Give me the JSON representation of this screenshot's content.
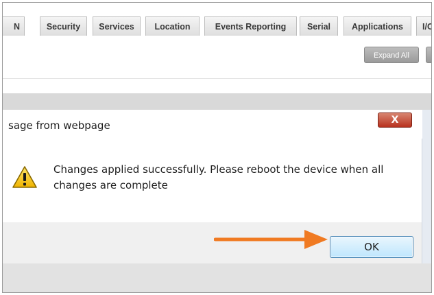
{
  "tabs": [
    {
      "label": "N"
    },
    {
      "label": "Security"
    },
    {
      "label": "Services"
    },
    {
      "label": "Location"
    },
    {
      "label": "Events Reporting"
    },
    {
      "label": "Serial"
    },
    {
      "label": "Applications"
    },
    {
      "label": "I/O"
    }
  ],
  "toolbar": {
    "expand_all_label": "Expand All"
  },
  "dialog": {
    "title": "sage from webpage",
    "close_label": "X",
    "message": "Changes applied successfully. Please reboot the device when all changes are complete",
    "ok_label": "OK",
    "icon": "warning-icon"
  },
  "annotation": {
    "arrow_icon": "orange-arrow-icon",
    "arrow_color": "#f07a22"
  },
  "colors": {
    "close_button": "#c0392b",
    "ok_border": "#3c7fb1"
  }
}
